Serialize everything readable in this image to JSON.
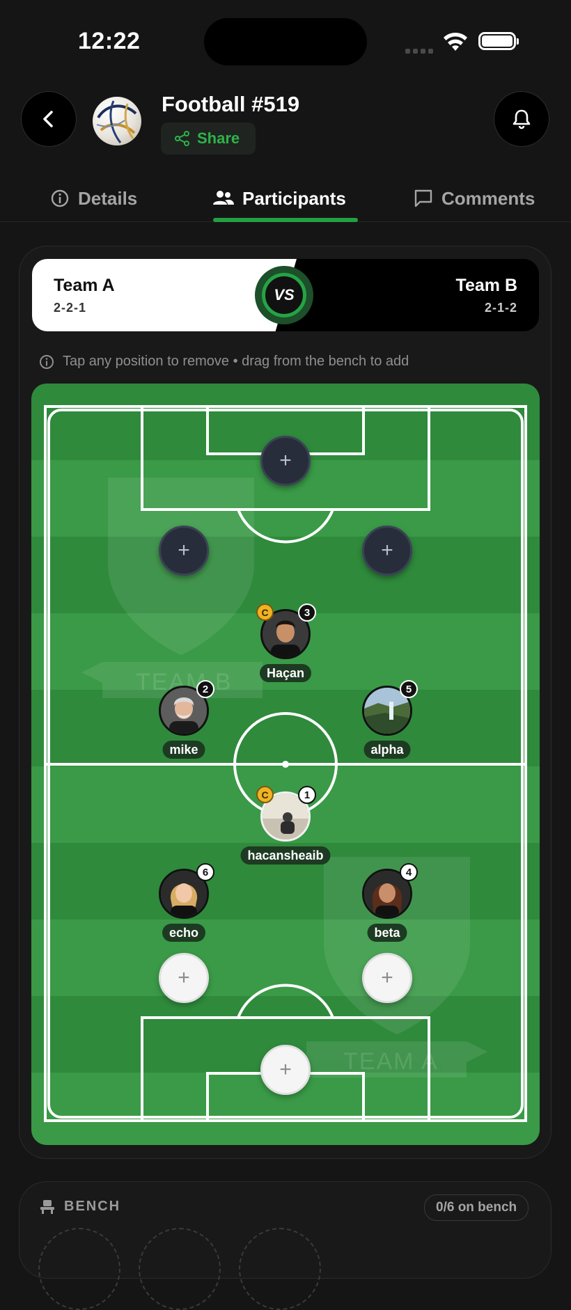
{
  "status": {
    "time": "12:22"
  },
  "header": {
    "title": "Football #519",
    "share_label": "Share"
  },
  "tabs": [
    {
      "label": "Details",
      "icon": "info-icon",
      "active": false
    },
    {
      "label": "Participants",
      "icon": "people-icon",
      "active": true
    },
    {
      "label": "Comments",
      "icon": "comment-icon",
      "active": false
    }
  ],
  "match": {
    "team_a": {
      "name": "Team A",
      "formation": "2-2-1"
    },
    "team_b": {
      "name": "Team B",
      "formation": "2-1-2"
    },
    "vs_label": "VS"
  },
  "hint": "Tap any position to remove • drag from the bench to add",
  "pitch": {
    "watermark_team_b": "TEAM B",
    "watermark_team_a": "TEAM A",
    "captain_badge": "C",
    "add_symbol": "+",
    "players": [
      {
        "name": "Haçan",
        "number": "3",
        "captain": true,
        "team": "B"
      },
      {
        "name": "mike",
        "number": "2",
        "captain": false,
        "team": "B"
      },
      {
        "name": "alpha",
        "number": "5",
        "captain": false,
        "team": "B"
      },
      {
        "name": "hacansheaib",
        "number": "1",
        "captain": true,
        "team": "A"
      },
      {
        "name": "echo",
        "number": "6",
        "captain": false,
        "team": "A"
      },
      {
        "name": "beta",
        "number": "4",
        "captain": false,
        "team": "A"
      }
    ]
  },
  "bench": {
    "label": "BENCH",
    "count": "0/6 on bench"
  },
  "colors": {
    "accent": "#23a043",
    "background": "#151515",
    "pitch": "#3a9a47"
  }
}
